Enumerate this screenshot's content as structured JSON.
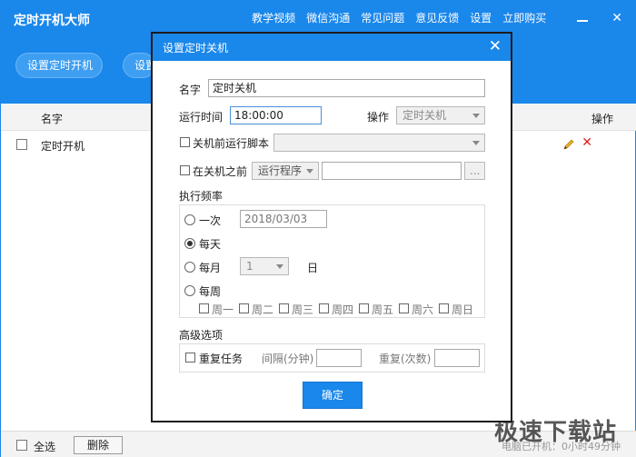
{
  "app": {
    "title": "定时开机大师",
    "nav": [
      "教学视频",
      "微信沟通",
      "常见问题",
      "意见反馈",
      "设置",
      "立即购买"
    ],
    "buttons": {
      "set_boot": "设置定时开机",
      "set_shutdown_partial": "设置"
    }
  },
  "list": {
    "col_name": "名字",
    "col_op": "操作",
    "rows": [
      {
        "name": "定时开机"
      }
    ]
  },
  "bottom": {
    "select_all": "全选",
    "delete": "删除",
    "status": "电脑已开机：0小时49分钟"
  },
  "watermark": "极速下载站",
  "dialog": {
    "title": "设置定时关机",
    "name_label": "名字",
    "name_value": "定时关机",
    "time_label": "运行时间",
    "time_value": "18:00:00",
    "op_label": "操作",
    "op_value": "定时关机",
    "script_label": "关机前运行脚本",
    "before_label": "在关机之前",
    "run_program": "运行程序",
    "browse": "...",
    "freq_label": "执行频率",
    "once": "一次",
    "once_date": "2018/03/03",
    "daily": "每天",
    "monthly": "每月",
    "month_day": "1",
    "day_unit": "日",
    "weekly": "每周",
    "weekdays": [
      "周一",
      "周二",
      "周三",
      "周四",
      "周五",
      "周六",
      "周日"
    ],
    "advanced_label": "高级选项",
    "repeat_label": "重复任务",
    "interval_label": "间隔(分钟)",
    "repeat_count_label": "重复(次数)",
    "ok": "确定"
  },
  "colors": {
    "accent": "#1a87eb",
    "delete": "#e02020"
  }
}
